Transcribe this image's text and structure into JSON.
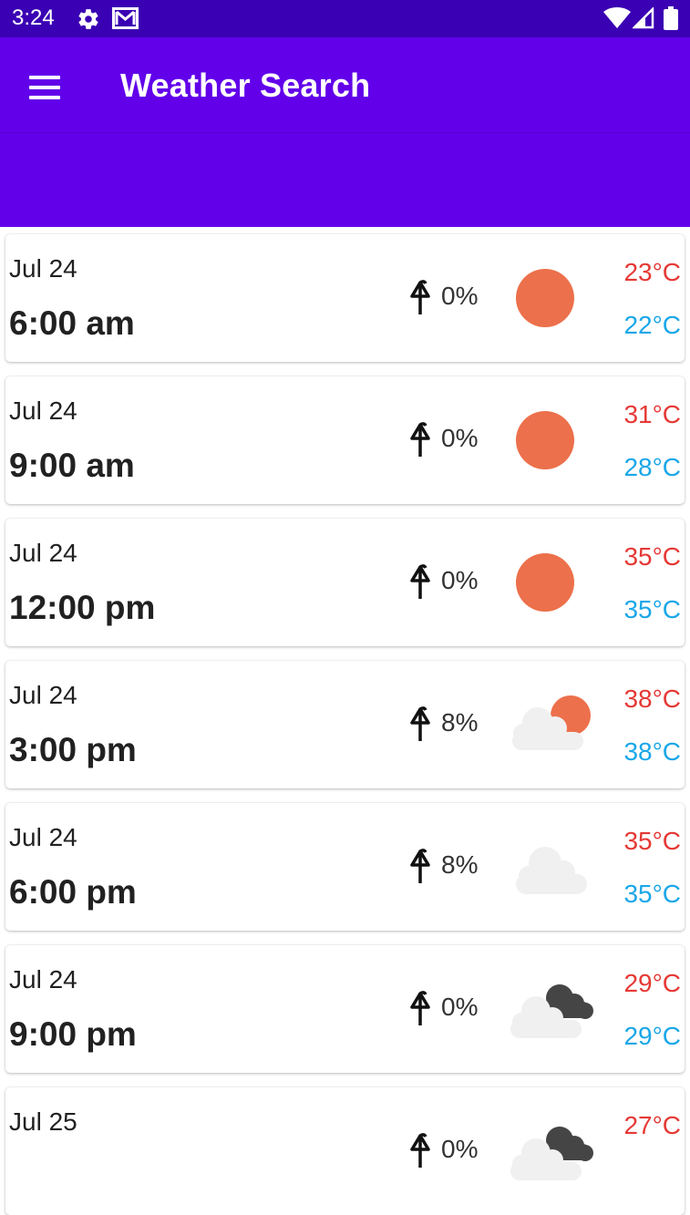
{
  "status_bar": {
    "time": "3:24",
    "icons": [
      "gear-icon",
      "mail-icon",
      "wifi-icon",
      "signal-icon",
      "battery-icon"
    ]
  },
  "app_bar": {
    "title": "Weather Search",
    "menu_icon": "hamburger-menu-icon",
    "background": "#6200ea"
  },
  "forecast": [
    {
      "date": "Jul 24",
      "time": "6:00 am",
      "rain": "0%",
      "icon": "sun-icon",
      "max": "23°C",
      "min": "22°C"
    },
    {
      "date": "Jul 24",
      "time": "9:00 am",
      "rain": "0%",
      "icon": "sun-icon",
      "max": "31°C",
      "min": "28°C"
    },
    {
      "date": "Jul 24",
      "time": "12:00 pm",
      "rain": "0%",
      "icon": "sun-icon",
      "max": "35°C",
      "min": "35°C"
    },
    {
      "date": "Jul 24",
      "time": "3:00 pm",
      "rain": "8%",
      "icon": "partly-cloudy-icon",
      "max": "38°C",
      "min": "38°C"
    },
    {
      "date": "Jul 24",
      "time": "6:00 pm",
      "rain": "8%",
      "icon": "cloud-icon",
      "max": "35°C",
      "min": "35°C"
    },
    {
      "date": "Jul 24",
      "time": "9:00 pm",
      "rain": "0%",
      "icon": "dark-clouds-icon",
      "max": "29°C",
      "min": "29°C"
    },
    {
      "date": "Jul 25",
      "time": "",
      "rain": "0%",
      "icon": "dark-clouds-icon",
      "max": "27°C",
      "min": ""
    }
  ],
  "colors": {
    "status_bar": "#3a00b3",
    "app_bar": "#6200ea",
    "max_temp": "#e53935",
    "min_temp": "#1aa7e8",
    "sun": "#ec704b"
  }
}
